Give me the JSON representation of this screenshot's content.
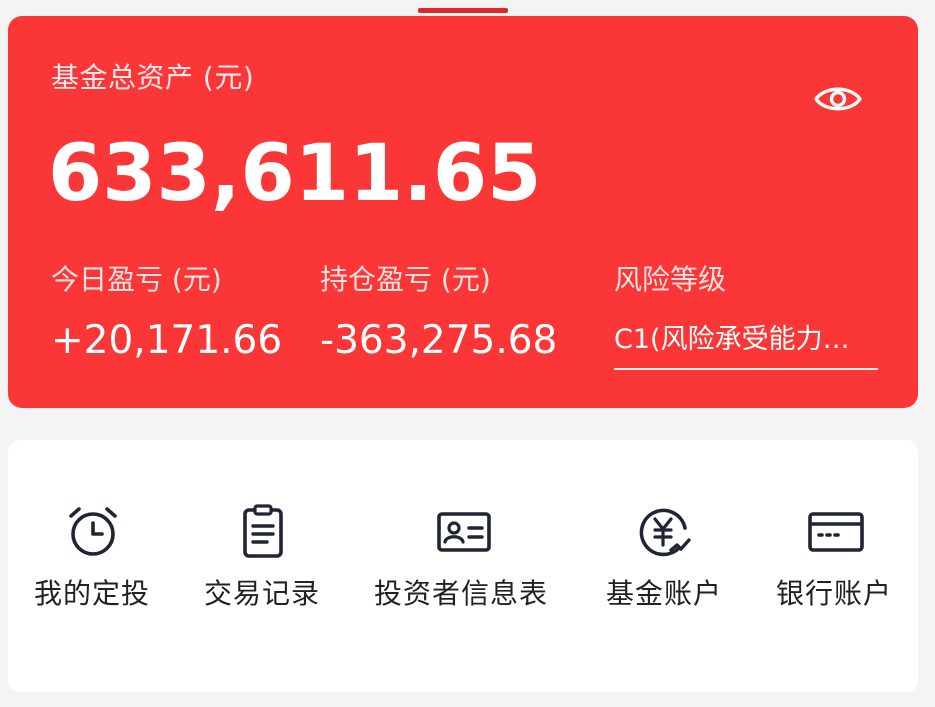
{
  "asset_card": {
    "total_label": "基金总资产 (元)",
    "total_value": "633,611.65",
    "eye_icon": "eye-icon",
    "today_pl_label": "今日盈亏 (元)",
    "today_pl_value": "+20,171.66",
    "holding_pl_label": "持仓盈亏 (元)",
    "holding_pl_value": "-363,275.68",
    "risk_label": "风险等级",
    "risk_value": "C1(风险承受能力…"
  },
  "menu": {
    "items": [
      {
        "label": "我的定投",
        "icon": "alarm-clock-icon"
      },
      {
        "label": "交易记录",
        "icon": "clipboard-icon"
      },
      {
        "label": "投资者信息表",
        "icon": "id-card-icon"
      },
      {
        "label": "基金账户",
        "icon": "yuan-coin-icon"
      },
      {
        "label": "银行账户",
        "icon": "bank-card-icon"
      }
    ]
  },
  "colors": {
    "brand_red": "#fb3636",
    "indicator_red": "#e0262c",
    "icon_dark": "#1f2533"
  }
}
